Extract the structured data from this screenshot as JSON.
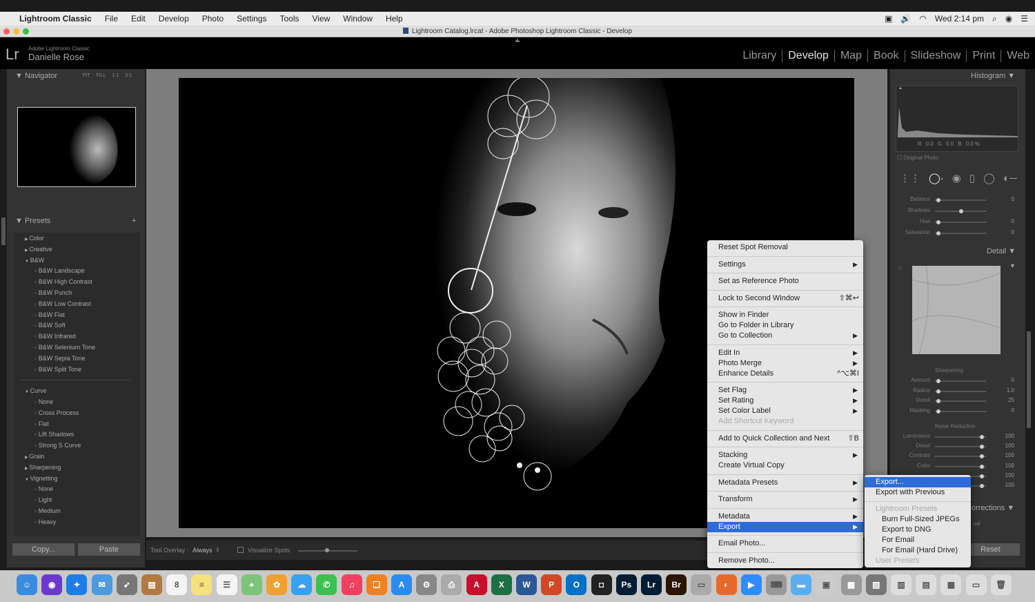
{
  "mac_menu": {
    "app": "Lightroom Classic",
    "items": [
      "File",
      "Edit",
      "Develop",
      "Photo",
      "Settings",
      "Tools",
      "View",
      "Window",
      "Help"
    ],
    "clock": "Wed 2:14 pm"
  },
  "window_title": "Lightroom Catalog.lrcat - Adobe Photoshop Lightroom Classic - Develop",
  "identity": {
    "logo": "Lr",
    "product": "Adobe Lightroom Classic",
    "user": "Danielle Rose"
  },
  "modules": [
    "Library",
    "Develop",
    "Map",
    "Book",
    "Slideshow",
    "Print",
    "Web"
  ],
  "active_module": "Develop",
  "navigator": {
    "title": "Navigator",
    "zoom": [
      "FIT",
      "FILL",
      "1:1",
      "3:1"
    ]
  },
  "presets": {
    "title": "Presets",
    "add": "+",
    "tree": [
      {
        "t": "Color",
        "lvl": 1,
        "open": false
      },
      {
        "t": "Creative",
        "lvl": 1,
        "open": false
      },
      {
        "t": "B&W",
        "lvl": 1,
        "open": true
      },
      {
        "t": "B&W Landscape",
        "lvl": 2
      },
      {
        "t": "B&W High Contrast",
        "lvl": 2
      },
      {
        "t": "B&W Punch",
        "lvl": 2
      },
      {
        "t": "B&W Low Contrast",
        "lvl": 2
      },
      {
        "t": "B&W Flat",
        "lvl": 2
      },
      {
        "t": "B&W Soft",
        "lvl": 2
      },
      {
        "t": "B&W Infrared",
        "lvl": 2
      },
      {
        "t": "B&W Selenium Tone",
        "lvl": 2
      },
      {
        "t": "B&W Sepia Tone",
        "lvl": 2
      },
      {
        "t": "B&W Split Tone",
        "lvl": 2
      },
      {
        "t": "",
        "lvl": 0
      },
      {
        "t": "Curve",
        "lvl": 1,
        "open": true
      },
      {
        "t": "None",
        "lvl": 2
      },
      {
        "t": "Cross Process",
        "lvl": 2
      },
      {
        "t": "Flat",
        "lvl": 2
      },
      {
        "t": "Lift Shadows",
        "lvl": 2
      },
      {
        "t": "Strong S Curve",
        "lvl": 2
      },
      {
        "t": "Grain",
        "lvl": 1,
        "open": false
      },
      {
        "t": "Sharpening",
        "lvl": 1,
        "open": false
      },
      {
        "t": "Vignetting",
        "lvl": 1,
        "open": true
      },
      {
        "t": "None",
        "lvl": 2
      },
      {
        "t": "Light",
        "lvl": 2
      },
      {
        "t": "Medium",
        "lvl": 2
      },
      {
        "t": "Heavy",
        "lvl": 2
      }
    ]
  },
  "left_buttons": {
    "copy": "Copy...",
    "paste": "Paste"
  },
  "toolbar": {
    "tool_overlay_label": "Tool Overlay :",
    "tool_overlay_value": "Always",
    "visualize": "Visualize Spots"
  },
  "histogram": {
    "title": "Histogram",
    "readout": [
      "R",
      "0.0",
      "G",
      "0.0",
      "B",
      "0.0 %"
    ],
    "original_photo": "Original Photo"
  },
  "right_sliders": [
    {
      "label": "Balance",
      "value": "0"
    },
    {
      "label": "Shadows",
      "value": ""
    },
    {
      "label": "Hue",
      "value": "0"
    },
    {
      "label": "Saturation",
      "value": "0"
    }
  ],
  "detail": {
    "title": "Detail",
    "sharpening": "Sharpening",
    "sharp_sliders": [
      {
        "label": "Amount",
        "value": "0"
      },
      {
        "label": "Radius",
        "value": "1.0"
      },
      {
        "label": "Detail",
        "value": "25"
      },
      {
        "label": "Masking",
        "value": "0"
      }
    ],
    "noise": "Noise Reduction",
    "noise_sliders": [
      {
        "label": "Luminance",
        "value": "100"
      },
      {
        "label": "Detail",
        "value": "100"
      },
      {
        "label": "Contrast",
        "value": "100"
      },
      {
        "label": "Color",
        "value": "100"
      },
      {
        "label": "",
        "value": "100"
      },
      {
        "label": "",
        "value": "100"
      }
    ],
    "corrections": "orrections",
    "corrections_sub": "ual"
  },
  "reset": "Reset",
  "context_menu": {
    "items": [
      {
        "t": "Reset Spot Removal"
      },
      {
        "sep": true
      },
      {
        "t": "Settings",
        "arrow": true
      },
      {
        "sep": true
      },
      {
        "t": "Set as Reference Photo"
      },
      {
        "sep": true
      },
      {
        "t": "Lock to Second Window",
        "sc": "⇧⌘↩"
      },
      {
        "sep": true
      },
      {
        "t": "Show in Finder"
      },
      {
        "t": "Go to Folder in Library"
      },
      {
        "t": "Go to Collection",
        "arrow": true
      },
      {
        "sep": true
      },
      {
        "t": "Edit In",
        "arrow": true
      },
      {
        "t": "Photo Merge",
        "arrow": true
      },
      {
        "t": "Enhance Details",
        "sc": "^⌥⌘I"
      },
      {
        "sep": true
      },
      {
        "t": "Set Flag",
        "arrow": true
      },
      {
        "t": "Set Rating",
        "arrow": true
      },
      {
        "t": "Set Color Label",
        "arrow": true
      },
      {
        "t": "Add Shortcut Keyword",
        "dis": true
      },
      {
        "sep": true
      },
      {
        "t": "Add to Quick Collection and Next",
        "sc": "⇧B"
      },
      {
        "sep": true
      },
      {
        "t": "Stacking",
        "arrow": true
      },
      {
        "t": "Create Virtual Copy"
      },
      {
        "sep": true
      },
      {
        "t": "Metadata Presets",
        "arrow": true
      },
      {
        "sep": true
      },
      {
        "t": "Transform",
        "arrow": true
      },
      {
        "sep": true
      },
      {
        "t": "Metadata",
        "arrow": true
      },
      {
        "t": "Export",
        "arrow": true,
        "sel": true
      },
      {
        "sep": true
      },
      {
        "t": "Email Photo..."
      },
      {
        "sep": true
      },
      {
        "t": "Remove Photo..."
      }
    ]
  },
  "export_submenu": {
    "items": [
      {
        "t": "Export...",
        "sel": true
      },
      {
        "t": "Export with Previous"
      },
      {
        "sep": true
      },
      {
        "t": "Lightroom Presets",
        "dis": true
      },
      {
        "t": "Burn Full-Sized JPEGs",
        "indent": true
      },
      {
        "t": "Export to DNG",
        "indent": true
      },
      {
        "t": "For Email",
        "indent": true
      },
      {
        "t": "For Email (Hard Drive)",
        "indent": true
      },
      {
        "t": "User Presets",
        "dis": true
      }
    ]
  },
  "dock_icons": [
    {
      "n": "finder",
      "c": "#3a8be0",
      "g": "☺"
    },
    {
      "n": "siri",
      "c": "#6a3ad0",
      "g": "◉"
    },
    {
      "n": "safari",
      "c": "#1e7ee8",
      "g": "✦"
    },
    {
      "n": "mail-stamp",
      "c": "#4c9ae0",
      "g": "✉"
    },
    {
      "n": "launchpad",
      "c": "#777",
      "g": "➶"
    },
    {
      "n": "notebook",
      "c": "#b07a40",
      "g": "▤"
    },
    {
      "n": "calendar",
      "c": "#f4f4f4",
      "g": "8"
    },
    {
      "n": "notes",
      "c": "#f6e27a",
      "g": "≡"
    },
    {
      "n": "reminders",
      "c": "#f4f4f4",
      "g": "☰"
    },
    {
      "n": "maps",
      "c": "#7cc47a",
      "g": "⌖"
    },
    {
      "n": "photos",
      "c": "#f0a030",
      "g": "✿"
    },
    {
      "n": "messages-blue",
      "c": "#3aa0f0",
      "g": "☁"
    },
    {
      "n": "messages",
      "c": "#3cc050",
      "g": "✆"
    },
    {
      "n": "music",
      "c": "#f04060",
      "g": "♫"
    },
    {
      "n": "books",
      "c": "#f08020",
      "g": "❑"
    },
    {
      "n": "app-store",
      "c": "#2a8cf0",
      "g": "A"
    },
    {
      "n": "system-preferences",
      "c": "#888",
      "g": "⚙"
    },
    {
      "n": "printer",
      "c": "#aaa",
      "g": "⎙"
    },
    {
      "n": "acrobat",
      "c": "#c8102e",
      "g": "A"
    },
    {
      "n": "excel",
      "c": "#1d7044",
      "g": "X"
    },
    {
      "n": "word",
      "c": "#2b5797",
      "g": "W"
    },
    {
      "n": "powerpoint",
      "c": "#d24726",
      "g": "P"
    },
    {
      "n": "outlook",
      "c": "#0072c6",
      "g": "O"
    },
    {
      "n": "camera",
      "c": "#222",
      "g": "◘"
    },
    {
      "n": "photoshop",
      "c": "#001d34",
      "g": "Ps"
    },
    {
      "n": "lightroom",
      "c": "#001d34",
      "g": "Lr"
    },
    {
      "n": "bridge",
      "c": "#2b1400",
      "g": "Br"
    },
    {
      "n": "scanner",
      "c": "#aaa",
      "g": "▭"
    },
    {
      "n": "firefox",
      "c": "#e8672a",
      "g": "◐"
    },
    {
      "n": "zoom",
      "c": "#2d8cff",
      "g": "▶"
    },
    {
      "n": "keyboard",
      "c": "#999",
      "g": "⌨"
    },
    {
      "n": "folder",
      "c": "#5aaef0",
      "g": "▬"
    },
    {
      "n": "preview",
      "c": "#ccc",
      "g": "▣"
    },
    {
      "n": "archive",
      "c": "#999",
      "g": "▦"
    },
    {
      "n": "photo-stack",
      "c": "#777",
      "g": "▧"
    },
    {
      "n": "documents",
      "c": "#ddd",
      "g": "▥"
    },
    {
      "n": "downloads",
      "c": "#ddd",
      "g": "▤"
    },
    {
      "n": "calculator",
      "c": "#ddd",
      "g": "▦"
    },
    {
      "n": "screen",
      "c": "#ddd",
      "g": "▭"
    },
    {
      "n": "trash",
      "c": "#ddd",
      "g": "🗑"
    }
  ]
}
